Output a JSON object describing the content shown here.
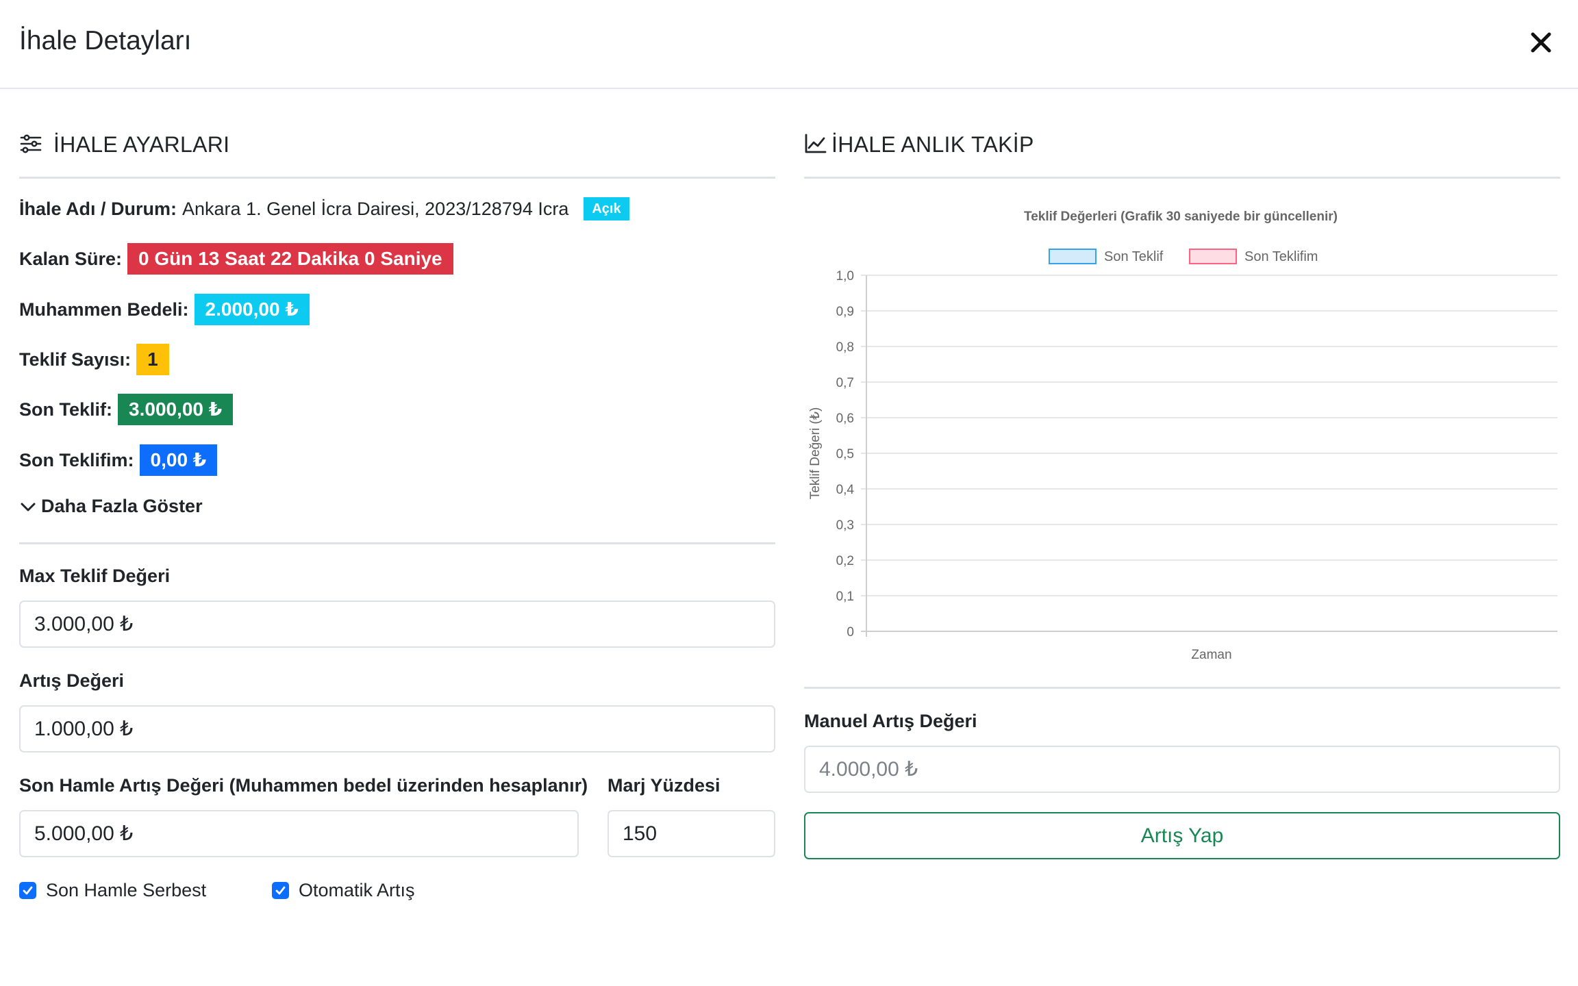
{
  "modal": {
    "title": "İhale Detayları"
  },
  "left": {
    "section_title": "İHALE AYARLARI",
    "info": {
      "name_label": "İhale Adı / Durum:",
      "name_value": "Ankara 1. Genel İcra Dairesi, 2023/128794 Icra",
      "status_badge": "Açık",
      "remaining_label": "Kalan Süre:",
      "remaining_value": "0 Gün 13 Saat 22 Dakika 0 Saniye",
      "estimated_label": "Muhammen Bedeli:",
      "estimated_value": "2.000,00 ₺",
      "bid_count_label": "Teklif Sayısı:",
      "bid_count_value": "1",
      "last_bid_label": "Son Teklif:",
      "last_bid_value": "3.000,00 ₺",
      "my_last_bid_label": "Son Teklifim:",
      "my_last_bid_value": "0,00 ₺"
    },
    "show_more": "Daha Fazla Göster",
    "fields": {
      "max_bid_label": "Max Teklif Değeri",
      "max_bid_value": "3.000,00 ₺",
      "increment_label": "Artış Değeri",
      "increment_value": "1.000,00 ₺",
      "last_move_label": "Son Hamle Artış Değeri (Muhammen bedel üzerinden hesaplanır)",
      "last_move_value": "5.000,00 ₺",
      "margin_label": "Marj Yüzdesi",
      "margin_value": "150"
    },
    "checkboxes": {
      "last_move_free": "Son Hamle Serbest",
      "auto_increment": "Otomatik Artış"
    }
  },
  "right": {
    "section_title": "İHALE ANLIK TAKİP",
    "manual_label": "Manuel Artış Değeri",
    "manual_placeholder": "4.000,00 ₺",
    "submit_button": "Artış Yap"
  },
  "colors": {
    "danger": "#dc3545",
    "info": "#0dcaf0",
    "warning": "#ffc107",
    "success": "#198754",
    "primary": "#0d6efd"
  },
  "chart_data": {
    "type": "line",
    "title": "Teklif Değerleri (Grafik 30 saniyede bir güncellenir)",
    "xlabel": "Zaman",
    "ylabel": "Teklif Değeri (₺)",
    "ylim": [
      0,
      1
    ],
    "y_ticks": [
      "0",
      "0,1",
      "0,2",
      "0,3",
      "0,4",
      "0,5",
      "0,6",
      "0,7",
      "0,8",
      "0,9",
      "1,0"
    ],
    "grid": true,
    "legend_position": "top",
    "series": [
      {
        "name": "Son Teklif",
        "color": "#36a2eb",
        "values": []
      },
      {
        "name": "Son Teklifim",
        "color": "#ff6384",
        "values": []
      }
    ]
  }
}
